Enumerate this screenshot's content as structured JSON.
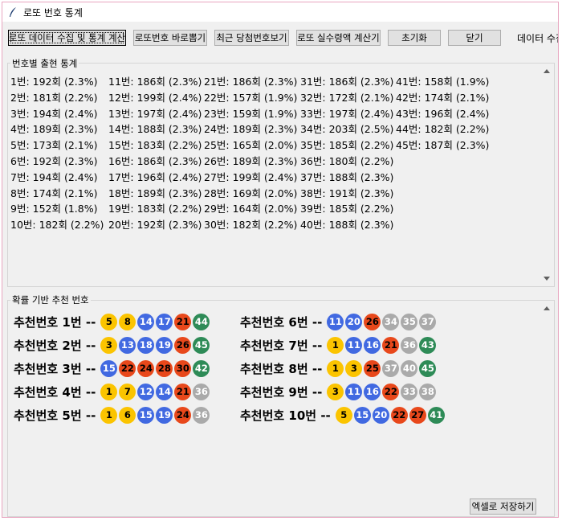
{
  "window": {
    "title": "로또 번호 통계"
  },
  "toolbar": {
    "btn_collect": "로또 데이터 수집 및 통계 계산",
    "btn_quick": "로또번호 바로뽑기",
    "btn_recent": "최근 당첨번호보기",
    "btn_calc": "로또 실수령액 계산기",
    "btn_reset": "초기화",
    "btn_close": "닫기",
    "status": "데이터 수집"
  },
  "stats_group": {
    "label": "번호별 출현 통계",
    "columns": [
      [
        "1번: 192회 (2.3%)",
        "2번: 181회 (2.2%)",
        "3번: 194회 (2.4%)",
        "4번: 189회 (2.3%)",
        "5번: 173회 (2.1%)",
        "6번: 192회 (2.3%)",
        "7번: 194회 (2.4%)",
        "8번: 174회 (2.1%)",
        "9번: 152회 (1.8%)",
        "10번: 182회 (2.2%)"
      ],
      [
        "11번: 186회 (2.3%)",
        "12번: 199회 (2.4%)",
        "13번: 197회 (2.4%)",
        "14번: 188회 (2.3%)",
        "15번: 183회 (2.2%)",
        "16번: 186회 (2.3%)",
        "17번: 196회 (2.4%)",
        "18번: 189회 (2.3%)",
        "19번: 183회 (2.2%)",
        "20번: 192회 (2.3%)"
      ],
      [
        "21번: 186회 (2.3%)",
        "22번: 157회 (1.9%)",
        "23번: 159회 (1.9%)",
        "24번: 189회 (2.3%)",
        "25번: 165회 (2.0%)",
        "26번: 189회 (2.3%)",
        "27번: 199회 (2.4%)",
        "28번: 169회 (2.0%)",
        "29번: 164회 (2.0%)",
        "30번: 182회 (2.2%)"
      ],
      [
        "31번: 186회 (2.3%)",
        "32번: 172회 (2.1%)",
        "33번: 197회 (2.4%)",
        "34번: 203회 (2.5%)",
        "35번: 185회 (2.2%)",
        "36번: 180회 (2.2%)",
        "37번: 188회 (2.3%)",
        "38번: 191회 (2.3%)",
        "39번: 185회 (2.2%)",
        "40번: 188회 (2.3%)"
      ],
      [
        "41번: 158회 (1.9%)",
        "42번: 174회 (2.1%)",
        "43번: 196회 (2.4%)",
        "44번: 182회 (2.2%)",
        "45번: 187회 (2.3%)"
      ]
    ]
  },
  "rec_group": {
    "label": "확률 기반 추천 번호",
    "sets": [
      {
        "label": "추천번호 1번 --",
        "numbers": [
          5,
          8,
          14,
          17,
          21,
          44
        ]
      },
      {
        "label": "추천번호 2번 --",
        "numbers": [
          3,
          13,
          18,
          19,
          26,
          45
        ]
      },
      {
        "label": "추천번호 3번 --",
        "numbers": [
          15,
          22,
          24,
          28,
          30,
          42
        ]
      },
      {
        "label": "추천번호 4번 --",
        "numbers": [
          1,
          7,
          12,
          14,
          21,
          36
        ]
      },
      {
        "label": "추천번호 5번 --",
        "numbers": [
          1,
          6,
          15,
          19,
          24,
          36
        ]
      },
      {
        "label": "추천번호 6번 --",
        "numbers": [
          11,
          20,
          26,
          34,
          35,
          37
        ]
      },
      {
        "label": "추천번호 7번 --",
        "numbers": [
          1,
          11,
          16,
          21,
          36,
          43
        ]
      },
      {
        "label": "추천번호 8번 --",
        "numbers": [
          1,
          3,
          25,
          37,
          40,
          45
        ]
      },
      {
        "label": "추천번호 9번 --",
        "numbers": [
          3,
          11,
          16,
          22,
          33,
          38
        ]
      },
      {
        "label": "추천번호 10번 --",
        "numbers": [
          5,
          15,
          20,
          22,
          27,
          41
        ]
      }
    ],
    "ball_colors": {
      "yellow": "#fbc400",
      "blue": "#4169e1",
      "red": "#e8481b",
      "gray": "#aaaaaa",
      "green": "#2e8b57"
    }
  },
  "footer": {
    "save_excel": "엑셀로 저장하기"
  }
}
